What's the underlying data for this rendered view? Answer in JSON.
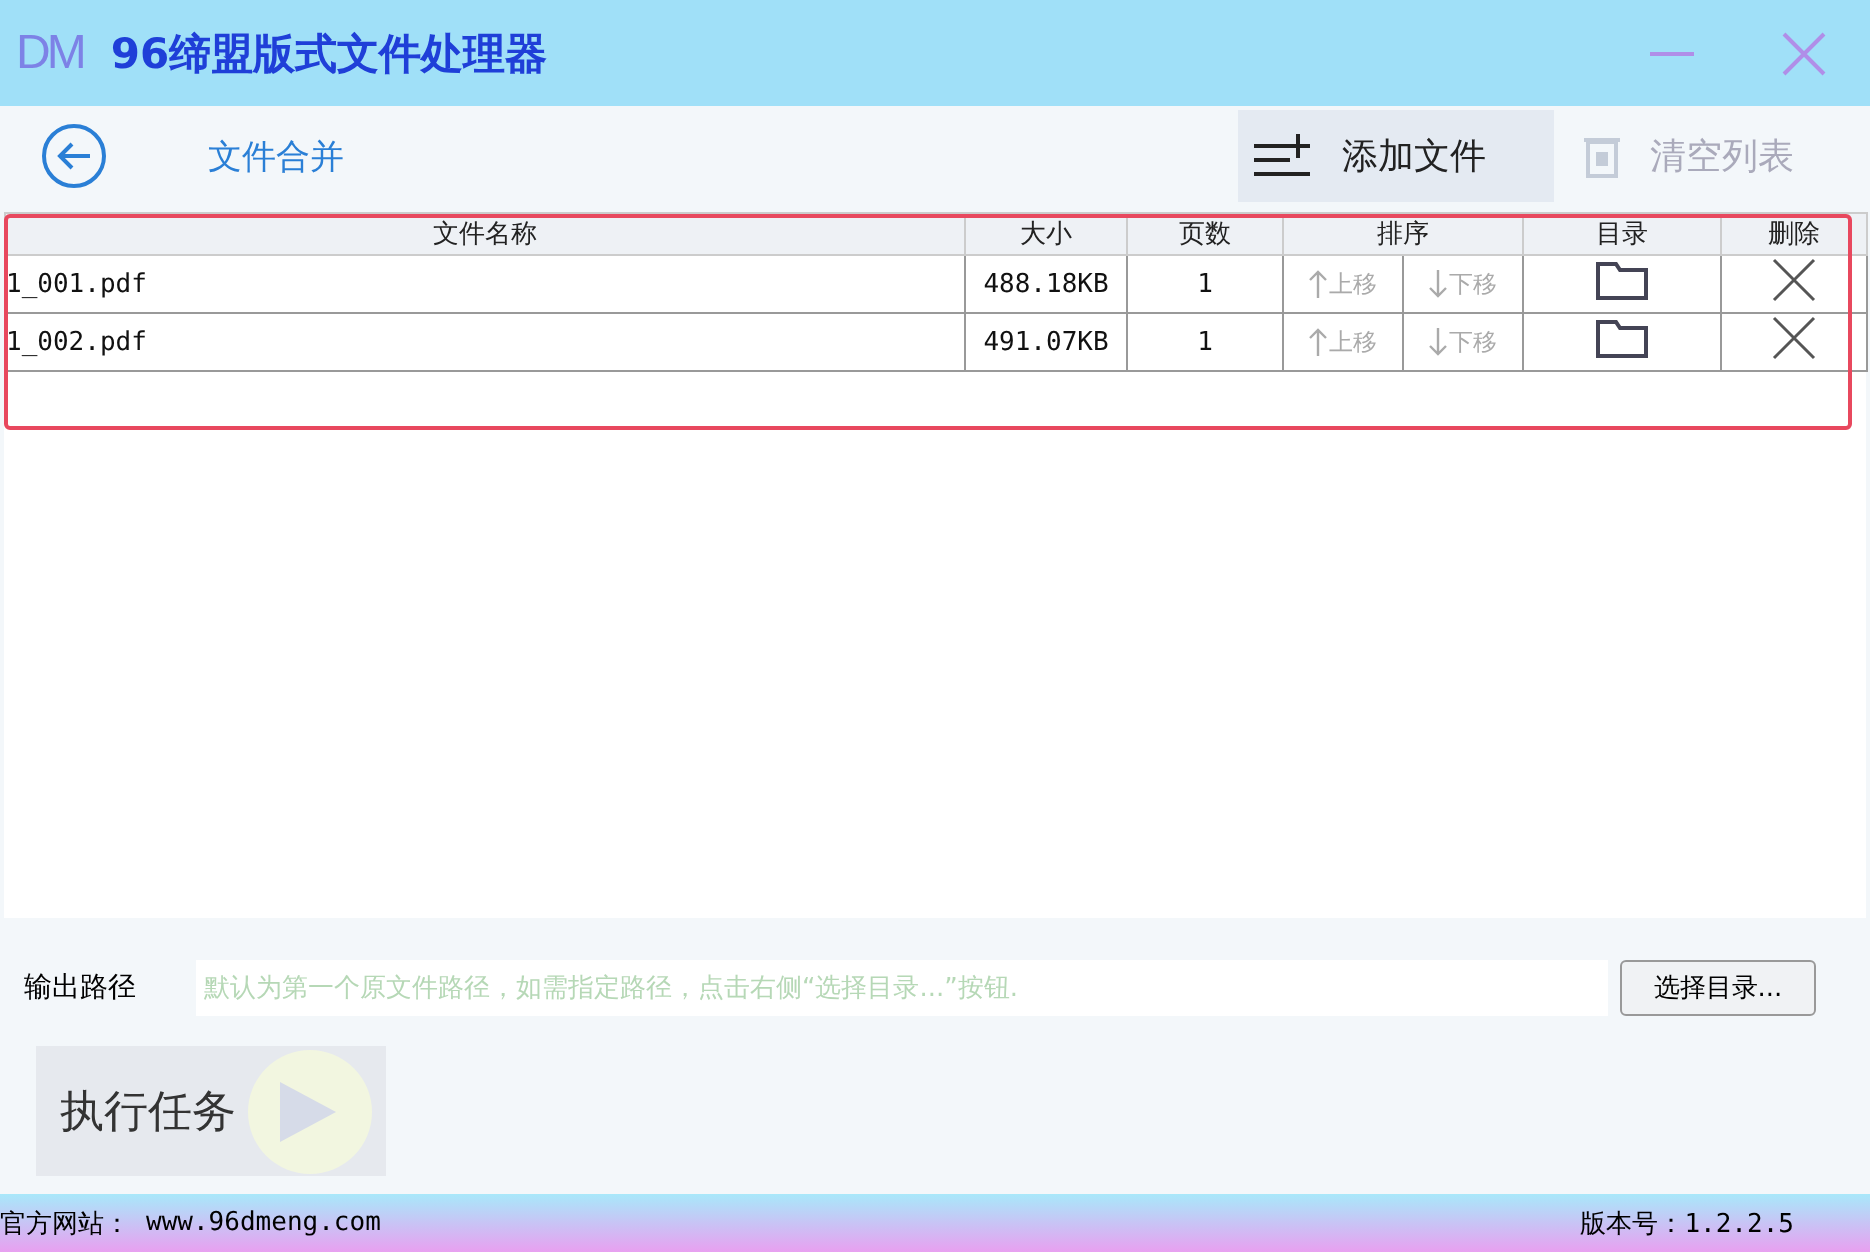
{
  "window": {
    "logo": "DM",
    "title": "96缔盟版式文件处理器"
  },
  "toolbar": {
    "page_title": "文件合并",
    "add_button": "添加文件",
    "clear_button": {
      "label": "清空列表",
      "disabled": true
    }
  },
  "table": {
    "columns": [
      "文件名称",
      "大小",
      "页数",
      "排序",
      "目录",
      "删除"
    ],
    "rows": [
      {
        "name": "1_001.pdf",
        "size": "488.18KB",
        "pages": "1",
        "up": "上移",
        "down": "下移"
      },
      {
        "name": "1_002.pdf",
        "size": "491.07KB",
        "pages": "1",
        "up": "上移",
        "down": "下移"
      }
    ]
  },
  "output": {
    "label": "输出路径",
    "placeholder": "默认为第一个原文件路径，如需指定路径，点击右侧“选择目录...”按钮.",
    "browse_button": "选择目录..."
  },
  "run_button": "执行任务",
  "status_bar": {
    "site_label": "官方网站：",
    "site": "www.96dmeng.com",
    "version_label": "版本号：",
    "version": "1.2.2.5"
  }
}
